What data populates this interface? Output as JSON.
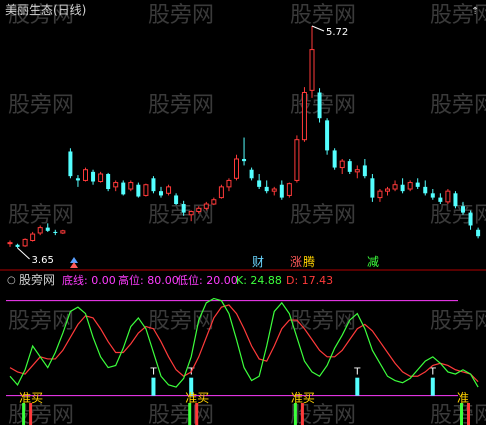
{
  "stock_title": "美丽生态(日线)",
  "price_high_label": "5.72",
  "price_low_label": "3.65",
  "upper_markers": [
    {
      "text": "财",
      "color": "#6ad6ff"
    },
    {
      "text": "涨",
      "color": "#ff5a5a"
    },
    {
      "text": "腾",
      "color": "#ffd200"
    },
    {
      "text": "减",
      "color": "#3cff3c"
    }
  ],
  "indicator": {
    "name": "股旁网",
    "items": [
      {
        "label": "底线:",
        "value": "0.00",
        "color": "#ff3cff"
      },
      {
        "label": "高位:",
        "value": "80.00",
        "color": "#ff3cff"
      },
      {
        "label": "低位:",
        "value": "20.00",
        "color": "#ff3cff"
      },
      {
        "label": "K:",
        "value": "24.88",
        "color": "#3cff3c"
      },
      {
        "label": "D:",
        "value": "17.43",
        "color": "#ff3a3a"
      }
    ]
  },
  "signals": {
    "buy_text": "准买",
    "buy_text_2": "准",
    "top_text": "T"
  },
  "watermark": "股旁网",
  "colors": {
    "up": "#ff3a3a",
    "down": "#54ffff",
    "k_line": "#3cff3c",
    "d_line": "#ff3a3a",
    "level": "#ff3cff"
  },
  "candles": [
    [
      3.7,
      3.72,
      3.66,
      3.7
    ],
    [
      3.68,
      3.69,
      3.65,
      3.66
    ],
    [
      3.67,
      3.74,
      3.66,
      3.73
    ],
    [
      3.72,
      3.8,
      3.71,
      3.78
    ],
    [
      3.79,
      3.86,
      3.77,
      3.84
    ],
    [
      3.84,
      3.88,
      3.8,
      3.81
    ],
    [
      3.8,
      3.82,
      3.77,
      3.79
    ],
    [
      3.79,
      3.82,
      3.78,
      3.81
    ],
    [
      4.55,
      4.58,
      4.3,
      4.32
    ],
    [
      4.3,
      4.33,
      4.22,
      4.28
    ],
    [
      4.28,
      4.4,
      4.27,
      4.38
    ],
    [
      4.36,
      4.38,
      4.24,
      4.27
    ],
    [
      4.27,
      4.36,
      4.26,
      4.34
    ],
    [
      4.34,
      4.35,
      4.18,
      4.2
    ],
    [
      4.22,
      4.28,
      4.18,
      4.26
    ],
    [
      4.26,
      4.28,
      4.14,
      4.15
    ],
    [
      4.2,
      4.28,
      4.18,
      4.26
    ],
    [
      4.24,
      4.26,
      4.12,
      4.13
    ],
    [
      4.14,
      4.25,
      4.13,
      4.24
    ],
    [
      4.3,
      4.32,
      4.16,
      4.18
    ],
    [
      4.18,
      4.22,
      4.12,
      4.14
    ],
    [
      4.16,
      4.24,
      4.14,
      4.22
    ],
    [
      4.14,
      4.16,
      4.05,
      4.06
    ],
    [
      4.06,
      4.09,
      3.95,
      3.98
    ],
    [
      3.96,
      4.0,
      3.9,
      3.99
    ],
    [
      3.99,
      4.04,
      3.97,
      4.02
    ],
    [
      4.02,
      4.08,
      4.0,
      4.06
    ],
    [
      4.06,
      4.12,
      4.05,
      4.1
    ],
    [
      4.12,
      4.24,
      4.11,
      4.22
    ],
    [
      4.22,
      4.3,
      4.18,
      4.28
    ],
    [
      4.3,
      4.52,
      4.28,
      4.48
    ],
    [
      4.48,
      4.68,
      4.42,
      4.46
    ],
    [
      4.38,
      4.4,
      4.28,
      4.3
    ],
    [
      4.28,
      4.34,
      4.2,
      4.22
    ],
    [
      4.22,
      4.28,
      4.16,
      4.18
    ],
    [
      4.18,
      4.22,
      4.14,
      4.2
    ],
    [
      4.24,
      4.28,
      4.1,
      4.12
    ],
    [
      4.14,
      4.26,
      4.12,
      4.25
    ],
    [
      4.28,
      4.7,
      4.26,
      4.66
    ],
    [
      4.66,
      5.15,
      4.64,
      5.1
    ],
    [
      5.12,
      5.72,
      5.05,
      5.5
    ],
    [
      5.1,
      5.14,
      4.82,
      4.86
    ],
    [
      4.84,
      4.86,
      4.52,
      4.56
    ],
    [
      4.56,
      4.58,
      4.38,
      4.4
    ],
    [
      4.4,
      4.48,
      4.34,
      4.46
    ],
    [
      4.46,
      4.48,
      4.34,
      4.36
    ],
    [
      4.36,
      4.42,
      4.3,
      4.38
    ],
    [
      4.42,
      4.48,
      4.3,
      4.32
    ],
    [
      4.3,
      4.34,
      4.08,
      4.12
    ],
    [
      4.12,
      4.2,
      4.08,
      4.18
    ],
    [
      4.18,
      4.22,
      4.14,
      4.2
    ],
    [
      4.2,
      4.28,
      4.18,
      4.24
    ],
    [
      4.24,
      4.3,
      4.16,
      4.18
    ],
    [
      4.2,
      4.28,
      4.18,
      4.26
    ],
    [
      4.26,
      4.3,
      4.2,
      4.22
    ],
    [
      4.22,
      4.28,
      4.14,
      4.16
    ],
    [
      4.16,
      4.2,
      4.1,
      4.12
    ],
    [
      4.12,
      4.16,
      4.06,
      4.08
    ],
    [
      4.08,
      4.2,
      4.06,
      4.18
    ],
    [
      4.16,
      4.18,
      4.02,
      4.04
    ],
    [
      4.04,
      4.08,
      3.96,
      3.98
    ],
    [
      3.98,
      4.0,
      3.82,
      3.86
    ],
    [
      3.82,
      3.84,
      3.74,
      3.76
    ]
  ],
  "kd": {
    "k": [
      22,
      14,
      28,
      50,
      40,
      30,
      44,
      62,
      82,
      86,
      80,
      58,
      40,
      30,
      32,
      48,
      68,
      76,
      66,
      44,
      22,
      14,
      12,
      20,
      40,
      74,
      90,
      94,
      92,
      80,
      56,
      30,
      18,
      22,
      50,
      82,
      90,
      80,
      58,
      36,
      26,
      22,
      32,
      48,
      60,
      74,
      80,
      66,
      46,
      34,
      22,
      18,
      16,
      20,
      28,
      36,
      40,
      34,
      26,
      24,
      28,
      24,
      12
    ],
    "d": [
      30,
      26,
      24,
      32,
      40,
      38,
      38,
      46,
      58,
      70,
      78,
      76,
      66,
      54,
      44,
      44,
      52,
      62,
      68,
      66,
      54,
      40,
      28,
      22,
      26,
      40,
      58,
      76,
      86,
      88,
      80,
      66,
      50,
      38,
      36,
      50,
      66,
      74,
      74,
      66,
      56,
      46,
      40,
      40,
      46,
      56,
      66,
      70,
      64,
      54,
      44,
      34,
      26,
      22,
      22,
      26,
      32,
      34,
      32,
      28,
      26,
      24,
      17
    ]
  },
  "signal_marks": {
    "tops": [
      19,
      24,
      46,
      56
    ],
    "buys": [
      2,
      24,
      38,
      60
    ]
  }
}
